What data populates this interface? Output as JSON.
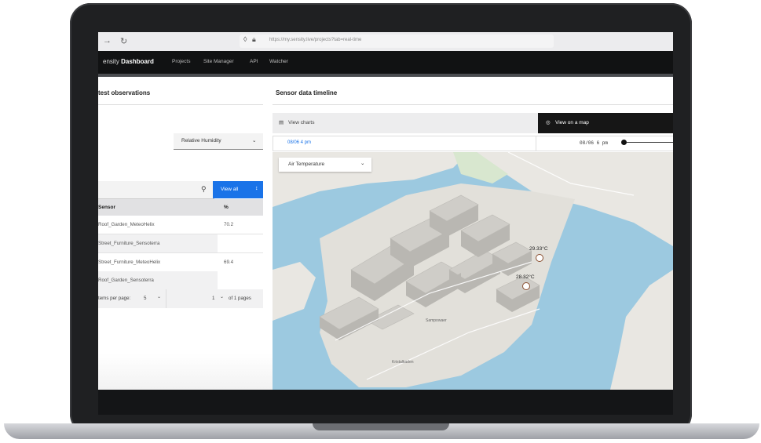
{
  "browser": {
    "url": "https://my.sensity.live/projects?tab=real-time"
  },
  "nav": {
    "brand_prefix": "ensity",
    "brand_strong": "Dashboard",
    "links": [
      "Projects",
      "Site Manager",
      "API",
      "Watcher"
    ]
  },
  "left": {
    "title": "test observations",
    "select_value": "Relative Humidity",
    "view_all": "View all",
    "table": {
      "headers": [
        "Sensor",
        "%"
      ],
      "rows": [
        {
          "sensor": "Roof_Garden_MeteoHelix",
          "value": "70.2"
        },
        {
          "sensor": "Street_Furniture_Sensoterra",
          "value": ""
        },
        {
          "sensor": "Street_Furniture_MeteoHelix",
          "value": "69.4"
        },
        {
          "sensor": "Roof_Garden_Sensoterra",
          "value": ""
        }
      ]
    },
    "pager": {
      "items_label": "tems per page:",
      "items_value": "5",
      "page_value": "1",
      "of_pages": "of 1 pages"
    }
  },
  "right": {
    "title": "Sensor data timeline",
    "view_charts": "View charts",
    "view_map": "View on a map",
    "time_start": "08/06 4 pm",
    "time_end": "08/06 6 pm",
    "map_select": "Air Temperature",
    "markers": [
      {
        "label": "29.33°C"
      },
      {
        "label": "28.32°C"
      }
    ],
    "map_labels": [
      "Sampowaer",
      "Kristalkaden"
    ]
  },
  "colors": {
    "water": "#9cc9e0",
    "accent": "#1a73e8",
    "nav_bg": "#111213"
  },
  "icons": [
    "back-arrow-icon",
    "reload-icon",
    "shield-icon",
    "lock-icon",
    "search-icon",
    "chart-icon",
    "target-icon",
    "chevron-down-icon"
  ]
}
